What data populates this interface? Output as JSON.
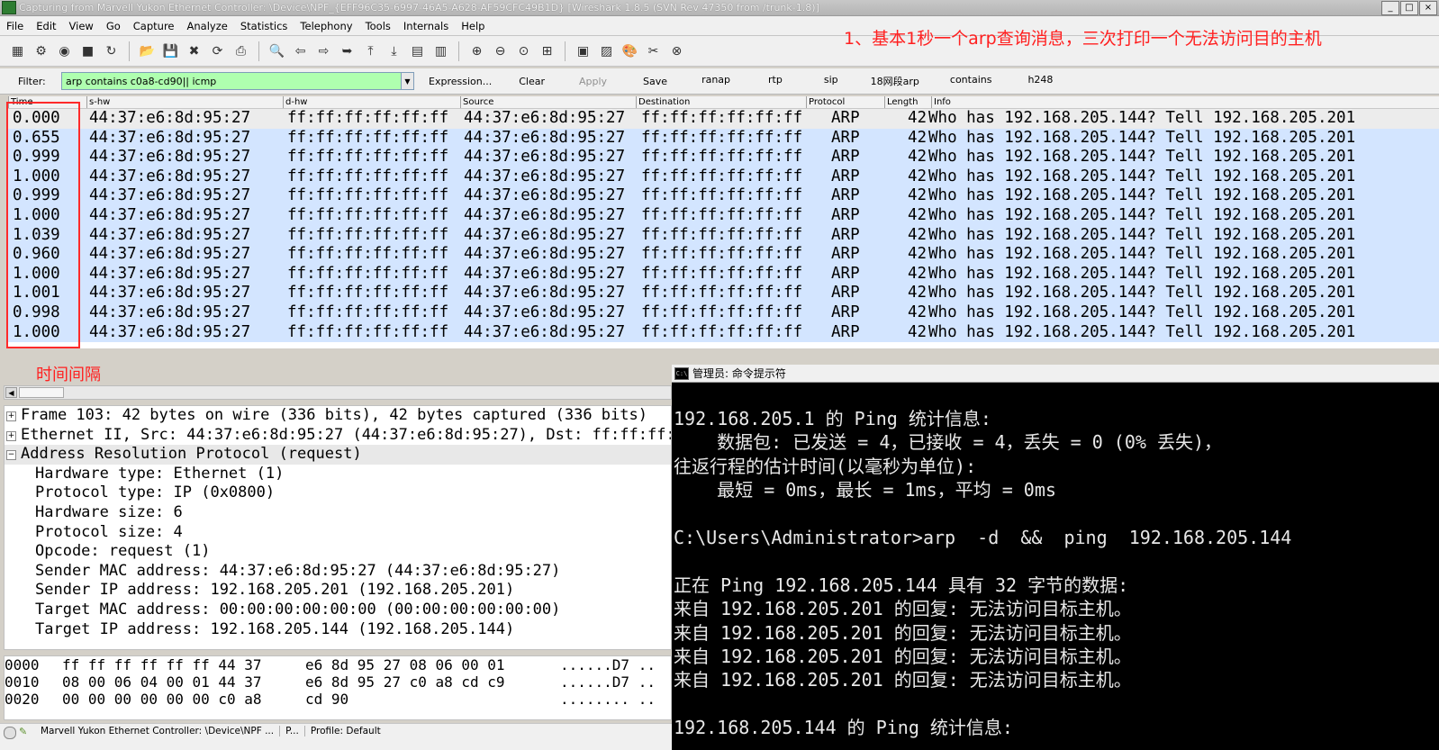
{
  "window": {
    "title": "Capturing from Marvell Yukon Ethernet Controller: \\Device\\NPF_{EFF96C35-6997-46A5-A628-AF59CFC49B1D}   [Wireshark 1.8.5  (SVN Rev 47350 from /trunk-1.8)]",
    "controls": [
      "_",
      "□",
      "×"
    ]
  },
  "menu": [
    "File",
    "Edit",
    "View",
    "Go",
    "Capture",
    "Analyze",
    "Statistics",
    "Telephony",
    "Tools",
    "Internals",
    "Help"
  ],
  "toolbar_icons": [
    "interfaces-icon",
    "options-icon",
    "start-icon",
    "stop-icon",
    "restart-icon",
    "open-icon",
    "save-icon",
    "close-icon",
    "reload-icon",
    "print-icon",
    "find-icon",
    "back-icon",
    "forward-icon",
    "goto-icon",
    "first-icon",
    "last-icon",
    "colorize-icon",
    "autoscroll-icon",
    "zoom-in-icon",
    "zoom-out-icon",
    "zoom-normal-icon",
    "resize-columns-icon",
    "capture-filters-icon",
    "display-filters-icon",
    "coloring-rules-icon",
    "preferences-icon",
    "help-icon"
  ],
  "annotations": {
    "top": "1、基本1秒一个arp查询消息，三次打印一个无法访问目的主机",
    "time": "时间间隔"
  },
  "filter": {
    "label": "Filter:",
    "value": "arp contains  c0a8-cd90|| icmp",
    "expression": "Expression...",
    "clear": "Clear",
    "apply": "Apply",
    "save": "Save",
    "buttons": [
      "ranap",
      "rtp",
      "sip",
      "18网段arp",
      "contains",
      "h248"
    ],
    "input_color": "#afffaf"
  },
  "packet_list": {
    "columns": [
      "Time",
      "s-hw",
      "d-hw",
      "Source",
      "Destination",
      "Protocol",
      "Length",
      "Info"
    ],
    "rows": [
      {
        "time": "0.000",
        "shw": "44:37:e6:8d:95:27",
        "dhw": "ff:ff:ff:ff:ff:ff",
        "src": "44:37:e6:8d:95:27",
        "dst": "ff:ff:ff:ff:ff:ff",
        "proto": "ARP",
        "len": "42",
        "info": "Who has 192.168.205.144?  Tell 192.168.205.201"
      },
      {
        "time": "0.655",
        "shw": "44:37:e6:8d:95:27",
        "dhw": "ff:ff:ff:ff:ff:ff",
        "src": "44:37:e6:8d:95:27",
        "dst": "ff:ff:ff:ff:ff:ff",
        "proto": "ARP",
        "len": "42",
        "info": "Who has 192.168.205.144?  Tell 192.168.205.201"
      },
      {
        "time": "0.999",
        "shw": "44:37:e6:8d:95:27",
        "dhw": "ff:ff:ff:ff:ff:ff",
        "src": "44:37:e6:8d:95:27",
        "dst": "ff:ff:ff:ff:ff:ff",
        "proto": "ARP",
        "len": "42",
        "info": "Who has 192.168.205.144?  Tell 192.168.205.201"
      },
      {
        "time": "1.000",
        "shw": "44:37:e6:8d:95:27",
        "dhw": "ff:ff:ff:ff:ff:ff",
        "src": "44:37:e6:8d:95:27",
        "dst": "ff:ff:ff:ff:ff:ff",
        "proto": "ARP",
        "len": "42",
        "info": "Who has 192.168.205.144?  Tell 192.168.205.201"
      },
      {
        "time": "0.999",
        "shw": "44:37:e6:8d:95:27",
        "dhw": "ff:ff:ff:ff:ff:ff",
        "src": "44:37:e6:8d:95:27",
        "dst": "ff:ff:ff:ff:ff:ff",
        "proto": "ARP",
        "len": "42",
        "info": "Who has 192.168.205.144?  Tell 192.168.205.201"
      },
      {
        "time": "1.000",
        "shw": "44:37:e6:8d:95:27",
        "dhw": "ff:ff:ff:ff:ff:ff",
        "src": "44:37:e6:8d:95:27",
        "dst": "ff:ff:ff:ff:ff:ff",
        "proto": "ARP",
        "len": "42",
        "info": "Who has 192.168.205.144?  Tell 192.168.205.201"
      },
      {
        "time": "1.039",
        "shw": "44:37:e6:8d:95:27",
        "dhw": "ff:ff:ff:ff:ff:ff",
        "src": "44:37:e6:8d:95:27",
        "dst": "ff:ff:ff:ff:ff:ff",
        "proto": "ARP",
        "len": "42",
        "info": "Who has 192.168.205.144?  Tell 192.168.205.201"
      },
      {
        "time": "0.960",
        "shw": "44:37:e6:8d:95:27",
        "dhw": "ff:ff:ff:ff:ff:ff",
        "src": "44:37:e6:8d:95:27",
        "dst": "ff:ff:ff:ff:ff:ff",
        "proto": "ARP",
        "len": "42",
        "info": "Who has 192.168.205.144?  Tell 192.168.205.201"
      },
      {
        "time": "1.000",
        "shw": "44:37:e6:8d:95:27",
        "dhw": "ff:ff:ff:ff:ff:ff",
        "src": "44:37:e6:8d:95:27",
        "dst": "ff:ff:ff:ff:ff:ff",
        "proto": "ARP",
        "len": "42",
        "info": "Who has 192.168.205.144?  Tell 192.168.205.201"
      },
      {
        "time": "1.001",
        "shw": "44:37:e6:8d:95:27",
        "dhw": "ff:ff:ff:ff:ff:ff",
        "src": "44:37:e6:8d:95:27",
        "dst": "ff:ff:ff:ff:ff:ff",
        "proto": "ARP",
        "len": "42",
        "info": "Who has 192.168.205.144?  Tell 192.168.205.201"
      },
      {
        "time": "0.998",
        "shw": "44:37:e6:8d:95:27",
        "dhw": "ff:ff:ff:ff:ff:ff",
        "src": "44:37:e6:8d:95:27",
        "dst": "ff:ff:ff:ff:ff:ff",
        "proto": "ARP",
        "len": "42",
        "info": "Who has 192.168.205.144?  Tell 192.168.205.201"
      },
      {
        "time": "1.000",
        "shw": "44:37:e6:8d:95:27",
        "dhw": "ff:ff:ff:ff:ff:ff",
        "src": "44:37:e6:8d:95:27",
        "dst": "ff:ff:ff:ff:ff:ff",
        "proto": "ARP",
        "len": "42",
        "info": "Who has 192.168.205.144?  Tell 192.168.205.201"
      }
    ],
    "row_color": "#d3e5ff"
  },
  "details": [
    {
      "expander": "+",
      "text": "Frame 103: 42 bytes on wire (336 bits), 42 bytes captured (336 bits)",
      "child": false
    },
    {
      "expander": "+",
      "text": "Ethernet II, Src: 44:37:e6:8d:95:27 (44:37:e6:8d:95:27), Dst: ff:ff:ff:ff:ff:ff",
      "child": false
    },
    {
      "expander": "−",
      "text": "Address Resolution Protocol (request)",
      "child": false,
      "selected": true
    },
    {
      "expander": "",
      "text": "Hardware type: Ethernet (1)",
      "child": true
    },
    {
      "expander": "",
      "text": "Protocol type: IP (0x0800)",
      "child": true
    },
    {
      "expander": "",
      "text": "Hardware size: 6",
      "child": true
    },
    {
      "expander": "",
      "text": "Protocol size: 4",
      "child": true
    },
    {
      "expander": "",
      "text": "Opcode: request (1)",
      "child": true
    },
    {
      "expander": "",
      "text": "Sender MAC address: 44:37:e6:8d:95:27 (44:37:e6:8d:95:27)",
      "child": true
    },
    {
      "expander": "",
      "text": "Sender IP address: 192.168.205.201 (192.168.205.201)",
      "child": true
    },
    {
      "expander": "",
      "text": "Target MAC address: 00:00:00:00:00:00 (00:00:00:00:00:00)",
      "child": true
    },
    {
      "expander": "",
      "text": "Target IP address: 192.168.205.144 (192.168.205.144)",
      "child": true
    }
  ],
  "bytes": [
    {
      "offset": "0000",
      "hex1": "ff ff ff ff ff ff 44 37",
      "hex2": "e6 8d 95 27 08 06 00 01",
      "ascii": "......D7 .."
    },
    {
      "offset": "0010",
      "hex1": "08 00 06 04 00 01 44 37",
      "hex2": "e6 8d 95 27 c0 a8 cd c9",
      "ascii": "......D7 .."
    },
    {
      "offset": "0020",
      "hex1": "00 00 00 00 00 00 c0 a8",
      "hex2": "cd 90",
      "ascii": "........ .."
    }
  ],
  "statusbar": {
    "interface": "Marvell Yukon Ethernet Controller: \\Device\\NPF ...",
    "packets": "P...",
    "profile": "Profile: Default"
  },
  "cmd": {
    "title": "管理员: 命令提示符",
    "icon_text": "C:\\",
    "lines": [
      "192.168.205.1 的 Ping 统计信息:",
      "    数据包: 已发送 = 4，已接收 = 4，丢失 = 0 (0% 丢失)，",
      "往返行程的估计时间(以毫秒为单位):",
      "    最短 = 0ms，最长 = 1ms，平均 = 0ms",
      "",
      "C:\\Users\\Administrator>arp  -d  &&  ping  192.168.205.144",
      "",
      "正在 Ping 192.168.205.144 具有 32 字节的数据:",
      "来自 192.168.205.201 的回复: 无法访问目标主机。",
      "来自 192.168.205.201 的回复: 无法访问目标主机。",
      "来自 192.168.205.201 的回复: 无法访问目标主机。",
      "来自 192.168.205.201 的回复: 无法访问目标主机。",
      "",
      "192.168.205.144 的 Ping 统计信息:"
    ]
  }
}
